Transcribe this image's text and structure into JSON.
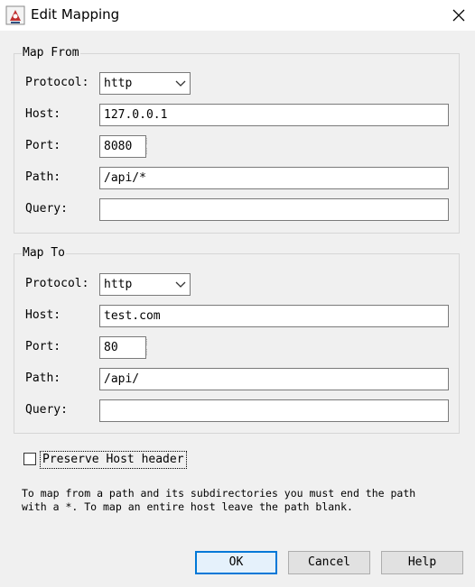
{
  "window": {
    "title": "Edit Mapping",
    "icon": "java-cup-icon",
    "close_icon": "close-icon"
  },
  "map_from": {
    "legend": "Map From",
    "protocol_label": "Protocol:",
    "protocol_value": "http",
    "host_label": "Host:",
    "host_value": "127.0.0.1",
    "port_label": "Port:",
    "port_value": "8080",
    "path_label": "Path:",
    "path_value": "/api/*",
    "query_label": "Query:",
    "query_value": ""
  },
  "map_to": {
    "legend": "Map To",
    "protocol_label": "Protocol:",
    "protocol_value": "http",
    "host_label": "Host:",
    "host_value": "test.com",
    "port_label": "Port:",
    "port_value": "80",
    "path_label": "Path:",
    "path_value": "/api/",
    "query_label": "Query:",
    "query_value": ""
  },
  "preserve_host": {
    "label": "Preserve Host header",
    "checked": false
  },
  "hint": "To map from a path and its subdirectories you must end the path\nwith a *. To map an entire host leave the path blank.",
  "buttons": {
    "ok": "OK",
    "cancel": "Cancel",
    "help": "Help"
  },
  "colors": {
    "focus_border": "#0078d7",
    "background": "#f0f0f0"
  }
}
